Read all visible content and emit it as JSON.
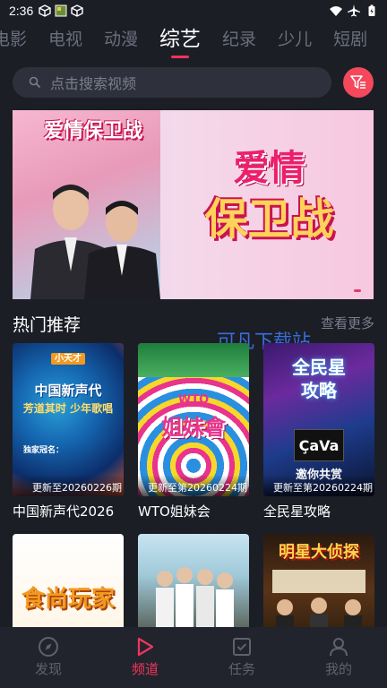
{
  "status_bar": {
    "time": "2:36"
  },
  "tabs": [
    {
      "label": "电影"
    },
    {
      "label": "电视"
    },
    {
      "label": "动漫"
    },
    {
      "label": "综艺"
    },
    {
      "label": "纪录"
    },
    {
      "label": "少儿"
    },
    {
      "label": "短剧"
    }
  ],
  "active_tab": "综艺",
  "search": {
    "placeholder": "点击搜索视频"
  },
  "banner": {
    "small_title": "爱情保卫战",
    "big_title_line1": "爱情",
    "big_title_line2": "保卫战"
  },
  "section": {
    "title": "热门推荐",
    "more": "查看更多"
  },
  "watermark": "可凡下载站",
  "cards": [
    {
      "title": "中国新声代2026",
      "update": "更新至20260226期",
      "poster_text": "中国新声代",
      "poster_sub": "芳道其时 少年歌唱",
      "poster_label": "独家冠名：",
      "poster_brand": "小天才"
    },
    {
      "title": "WTO姐妹会",
      "update": "更新至第20260224期",
      "poster_text": "姐妹會",
      "poster_brand": "WTO"
    },
    {
      "title": "全民星攻略",
      "update": "更新至第20260224期",
      "poster_text": "全民星攻略",
      "poster_brand": "ÇaVa",
      "poster_sub": "邀你共赏"
    }
  ],
  "cards_row2": [
    {
      "poster_text": "食尚玩家"
    },
    {
      "poster_text": ""
    },
    {
      "poster_text": "明星大侦探"
    }
  ],
  "bottom_nav": [
    {
      "label": "发现",
      "icon": "compass-icon"
    },
    {
      "label": "频道",
      "icon": "play-icon"
    },
    {
      "label": "任务",
      "icon": "task-icon"
    },
    {
      "label": "我的",
      "icon": "user-icon"
    }
  ],
  "colors": {
    "accent": "#f2345c",
    "background": "#1c1e26",
    "inactive": "#5e626e"
  }
}
